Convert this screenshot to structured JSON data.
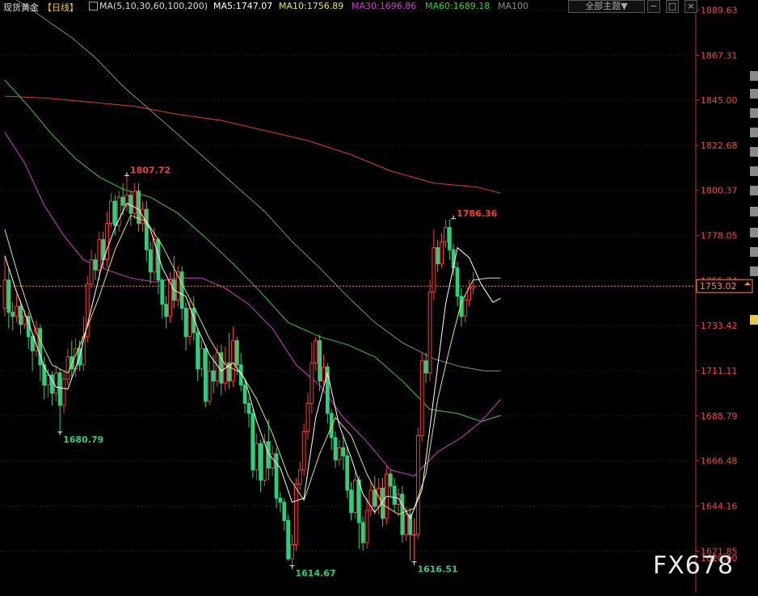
{
  "header": {
    "instrument": "现货黄金",
    "period": "【日线】",
    "ma_label": "MA(5,10,30,60,100,200)",
    "ma5": "MA5:1747.07",
    "ma10": "MA10:1756.89",
    "ma30": "MA30:1696.86",
    "ma60": "MA60:1689.18",
    "ma100": "MA100",
    "theme_button": "全部主题▼"
  },
  "colors": {
    "background": "#000000",
    "up": "#ff3b30",
    "down": "#2ad07a",
    "ma5": "#ffffff",
    "ma10": "#e8e84a",
    "ma30": "#d63ad6",
    "ma60": "#2ed62e",
    "ma100": "#8a8a8a",
    "ma200": "#e83a2a",
    "axis_text": "#ff4040",
    "price_line": "#ff8c3a"
  },
  "chart_data": {
    "type": "candlestick",
    "ylim": [
      1614,
      1893
    ],
    "y_ticks": [
      "1889.63",
      "1867.31",
      "1845.00",
      "1822.68",
      "1800.37",
      "1778.05",
      "1755.74",
      "1733.42",
      "1711.11",
      "1688.79",
      "1666.48",
      "1644.16",
      "1621.85"
    ],
    "y_tick_values": [
      1889.63,
      1867.31,
      1845.0,
      1822.68,
      1800.37,
      1778.05,
      1755.74,
      1733.42,
      1711.11,
      1688.79,
      1666.48,
      1644.16,
      1621.85
    ],
    "current_price": "1753.02",
    "current_price_value": 1753.02,
    "bottom_partial_label": "1620.00",
    "annotations": [
      {
        "text": "1807.72",
        "bar": 31,
        "price": 1807.72,
        "kind": "high"
      },
      {
        "text": "1680.79",
        "bar": 14,
        "price": 1680.79,
        "kind": "low"
      },
      {
        "text": "1614.67",
        "bar": 73,
        "price": 1614.67,
        "kind": "low"
      },
      {
        "text": "1616.51",
        "bar": 104,
        "price": 1616.51,
        "kind": "low"
      },
      {
        "text": "1786.36",
        "bar": 114,
        "price": 1786.36,
        "kind": "high"
      }
    ],
    "candles": [
      [
        1742,
        1756,
        1738,
        1768
      ],
      [
        1756,
        1740,
        1732,
        1762
      ],
      [
        1740,
        1738,
        1731,
        1745
      ],
      [
        1738,
        1743,
        1735,
        1749
      ],
      [
        1743,
        1734,
        1729,
        1746
      ],
      [
        1734,
        1738,
        1732,
        1741
      ],
      [
        1738,
        1728,
        1722,
        1740
      ],
      [
        1728,
        1721,
        1711,
        1730
      ],
      [
        1721,
        1732,
        1718,
        1736
      ],
      [
        1732,
        1714,
        1706,
        1734
      ],
      [
        1714,
        1704,
        1697,
        1718
      ],
      [
        1704,
        1709,
        1698,
        1712
      ],
      [
        1709,
        1700,
        1694,
        1711
      ],
      [
        1700,
        1710,
        1696,
        1714
      ],
      [
        1710,
        1694,
        1681,
        1712
      ],
      [
        1694,
        1707,
        1690,
        1711
      ],
      [
        1707,
        1718,
        1704,
        1722
      ],
      [
        1718,
        1712,
        1708,
        1726
      ],
      [
        1712,
        1722,
        1708,
        1727
      ],
      [
        1722,
        1714,
        1711,
        1726
      ],
      [
        1714,
        1728,
        1711,
        1738
      ],
      [
        1728,
        1754,
        1725,
        1758
      ],
      [
        1754,
        1766,
        1752,
        1771
      ],
      [
        1766,
        1761,
        1756,
        1769
      ],
      [
        1761,
        1776,
        1756,
        1780
      ],
      [
        1776,
        1766,
        1762,
        1780
      ],
      [
        1766,
        1784,
        1762,
        1790
      ],
      [
        1784,
        1795,
        1782,
        1799
      ],
      [
        1795,
        1783,
        1778,
        1798
      ],
      [
        1783,
        1797,
        1780,
        1800
      ],
      [
        1797,
        1793,
        1788,
        1804
      ],
      [
        1793,
        1798,
        1790,
        1808
      ],
      [
        1798,
        1789,
        1783,
        1800
      ],
      [
        1789,
        1800,
        1786,
        1804
      ],
      [
        1800,
        1784,
        1780,
        1804
      ],
      [
        1784,
        1791,
        1780,
        1795
      ],
      [
        1791,
        1771,
        1765,
        1795
      ],
      [
        1771,
        1760,
        1754,
        1775
      ],
      [
        1760,
        1776,
        1756,
        1782
      ],
      [
        1776,
        1756,
        1749,
        1777
      ],
      [
        1756,
        1744,
        1737,
        1757
      ],
      [
        1744,
        1738,
        1732,
        1748
      ],
      [
        1738,
        1756,
        1735,
        1760
      ],
      [
        1756,
        1746,
        1742,
        1768
      ],
      [
        1746,
        1760,
        1743,
        1763
      ],
      [
        1760,
        1742,
        1736,
        1763
      ],
      [
        1742,
        1728,
        1721,
        1745
      ],
      [
        1728,
        1742,
        1724,
        1746
      ],
      [
        1742,
        1730,
        1726,
        1748
      ],
      [
        1730,
        1712,
        1706,
        1732
      ],
      [
        1712,
        1722,
        1708,
        1726
      ],
      [
        1722,
        1696,
        1693,
        1724
      ],
      [
        1696,
        1711,
        1694,
        1716
      ],
      [
        1711,
        1706,
        1700,
        1719
      ],
      [
        1706,
        1720,
        1703,
        1724
      ],
      [
        1720,
        1705,
        1699,
        1724
      ],
      [
        1705,
        1715,
        1701,
        1723
      ],
      [
        1715,
        1706,
        1702,
        1730
      ],
      [
        1706,
        1726,
        1703,
        1733
      ],
      [
        1726,
        1714,
        1709,
        1728
      ],
      [
        1714,
        1704,
        1701,
        1720
      ],
      [
        1704,
        1695,
        1690,
        1707
      ],
      [
        1695,
        1690,
        1683,
        1698
      ],
      [
        1690,
        1662,
        1658,
        1692
      ],
      [
        1662,
        1675,
        1657,
        1680
      ],
      [
        1675,
        1657,
        1651,
        1677
      ],
      [
        1657,
        1676,
        1654,
        1680
      ],
      [
        1676,
        1663,
        1657,
        1687
      ],
      [
        1663,
        1670,
        1659,
        1674
      ],
      [
        1670,
        1648,
        1643,
        1673
      ],
      [
        1648,
        1646,
        1641,
        1651
      ],
      [
        1646,
        1637,
        1632,
        1648
      ],
      [
        1637,
        1618,
        1617,
        1640
      ],
      [
        1618,
        1625,
        1615,
        1630
      ],
      [
        1625,
        1655,
        1622,
        1658
      ],
      [
        1655,
        1662,
        1652,
        1666
      ],
      [
        1662,
        1681,
        1659,
        1685
      ],
      [
        1681,
        1695,
        1677,
        1700
      ],
      [
        1695,
        1715,
        1690,
        1725
      ],
      [
        1715,
        1726,
        1711,
        1728
      ],
      [
        1726,
        1706,
        1701,
        1729
      ],
      [
        1706,
        1713,
        1704,
        1719
      ],
      [
        1713,
        1690,
        1685,
        1715
      ],
      [
        1690,
        1678,
        1672,
        1692
      ],
      [
        1678,
        1667,
        1663,
        1681
      ],
      [
        1667,
        1673,
        1664,
        1677
      ],
      [
        1673,
        1669,
        1662,
        1679
      ],
      [
        1669,
        1652,
        1648,
        1674
      ],
      [
        1652,
        1641,
        1637,
        1656
      ],
      [
        1641,
        1657,
        1638,
        1661
      ],
      [
        1657,
        1636,
        1623,
        1659
      ],
      [
        1636,
        1626,
        1622,
        1639
      ],
      [
        1626,
        1642,
        1623,
        1648
      ],
      [
        1642,
        1652,
        1639,
        1656
      ],
      [
        1652,
        1644,
        1640,
        1659
      ],
      [
        1644,
        1653,
        1640,
        1658
      ],
      [
        1653,
        1638,
        1634,
        1658
      ],
      [
        1638,
        1660,
        1635,
        1664
      ],
      [
        1660,
        1654,
        1649,
        1662
      ],
      [
        1654,
        1645,
        1641,
        1658
      ],
      [
        1645,
        1650,
        1639,
        1653
      ],
      [
        1650,
        1630,
        1626,
        1654
      ],
      [
        1630,
        1640,
        1627,
        1644
      ],
      [
        1640,
        1630,
        1617,
        1643
      ],
      [
        1630,
        1630,
        1617,
        1638
      ],
      [
        1630,
        1679,
        1628,
        1683
      ],
      [
        1679,
        1716,
        1676,
        1720
      ],
      [
        1716,
        1710,
        1705,
        1720
      ],
      [
        1710,
        1750,
        1706,
        1756
      ],
      [
        1750,
        1772,
        1746,
        1781
      ],
      [
        1772,
        1764,
        1760,
        1776
      ],
      [
        1764,
        1775,
        1762,
        1779
      ],
      [
        1775,
        1782,
        1772,
        1786
      ],
      [
        1782,
        1771,
        1766,
        1786
      ],
      [
        1771,
        1762,
        1758,
        1774
      ],
      [
        1762,
        1748,
        1743,
        1765
      ],
      [
        1748,
        1738,
        1733,
        1752
      ],
      [
        1738,
        1746,
        1735,
        1749
      ],
      [
        1746,
        1752,
        1743,
        1756
      ],
      [
        1752,
        1753,
        1749,
        1760
      ]
    ],
    "ma100_points": [
      [
        0,
        1898
      ],
      [
        6,
        1891
      ],
      [
        11,
        1884
      ],
      [
        17,
        1876
      ],
      [
        23,
        1866
      ],
      [
        30,
        1852
      ],
      [
        37,
        1840
      ],
      [
        44,
        1828
      ],
      [
        51,
        1816
      ],
      [
        59,
        1802
      ],
      [
        66,
        1790
      ],
      [
        73,
        1775
      ],
      [
        80,
        1762
      ],
      [
        87,
        1748
      ],
      [
        94,
        1735
      ],
      [
        101,
        1725
      ],
      [
        109,
        1717
      ],
      [
        116,
        1713
      ],
      [
        122,
        1711
      ],
      [
        126,
        1711
      ]
    ],
    "ma200_points": [
      [
        0,
        1847
      ],
      [
        11,
        1846
      ],
      [
        22,
        1844
      ],
      [
        33,
        1842
      ],
      [
        44,
        1838
      ],
      [
        55,
        1835
      ],
      [
        66,
        1830
      ],
      [
        77,
        1825
      ],
      [
        88,
        1818
      ],
      [
        98,
        1810
      ],
      [
        109,
        1804
      ],
      [
        120,
        1802
      ],
      [
        126,
        1799
      ]
    ],
    "ma60_points": [
      [
        0,
        1855
      ],
      [
        6,
        1842
      ],
      [
        12,
        1828
      ],
      [
        18,
        1816
      ],
      [
        24,
        1807
      ],
      [
        30,
        1801
      ],
      [
        37,
        1797
      ],
      [
        44,
        1789
      ],
      [
        51,
        1777
      ],
      [
        58,
        1764
      ],
      [
        65,
        1750
      ],
      [
        72,
        1735
      ],
      [
        80,
        1728
      ],
      [
        87,
        1724
      ],
      [
        94,
        1718
      ],
      [
        101,
        1706
      ],
      [
        108,
        1692
      ],
      [
        115,
        1690
      ],
      [
        121,
        1686
      ],
      [
        126,
        1689
      ]
    ],
    "ma30_points": [
      [
        0,
        1829
      ],
      [
        5,
        1814
      ],
      [
        10,
        1793
      ],
      [
        15,
        1778
      ],
      [
        20,
        1766
      ],
      [
        26,
        1761
      ],
      [
        32,
        1757
      ],
      [
        38,
        1755
      ],
      [
        44,
        1757
      ],
      [
        50,
        1757
      ],
      [
        56,
        1752
      ],
      [
        62,
        1744
      ],
      [
        68,
        1732
      ],
      [
        74,
        1714
      ],
      [
        80,
        1704
      ],
      [
        86,
        1688
      ],
      [
        92,
        1676
      ],
      [
        98,
        1662
      ],
      [
        104,
        1659
      ],
      [
        110,
        1671
      ],
      [
        116,
        1678
      ],
      [
        121,
        1686
      ],
      [
        126,
        1697
      ]
    ],
    "ma10_points": [
      [
        0,
        1781
      ],
      [
        4,
        1754
      ],
      [
        8,
        1730
      ],
      [
        12,
        1714
      ],
      [
        16,
        1710
      ],
      [
        20,
        1728
      ],
      [
        24,
        1748
      ],
      [
        28,
        1771
      ],
      [
        32,
        1788
      ],
      [
        36,
        1785
      ],
      [
        40,
        1773
      ],
      [
        44,
        1758
      ],
      [
        48,
        1743
      ],
      [
        52,
        1727
      ],
      [
        56,
        1714
      ],
      [
        60,
        1710
      ],
      [
        64,
        1697
      ],
      [
        68,
        1680
      ],
      [
        72,
        1659
      ],
      [
        76,
        1647
      ],
      [
        80,
        1670
      ],
      [
        84,
        1688
      ],
      [
        88,
        1679
      ],
      [
        92,
        1660
      ],
      [
        96,
        1645
      ],
      [
        100,
        1640
      ],
      [
        104,
        1643
      ],
      [
        107,
        1660
      ],
      [
        110,
        1697
      ],
      [
        113,
        1722
      ],
      [
        116,
        1745
      ],
      [
        119,
        1756
      ],
      [
        123,
        1757
      ],
      [
        126,
        1757
      ]
    ],
    "ma5_points": [
      [
        0,
        1768
      ],
      [
        3,
        1750
      ],
      [
        6,
        1735
      ],
      [
        10,
        1713
      ],
      [
        13,
        1703
      ],
      [
        16,
        1702
      ],
      [
        19,
        1718
      ],
      [
        22,
        1742
      ],
      [
        25,
        1766
      ],
      [
        28,
        1782
      ],
      [
        31,
        1794
      ],
      [
        34,
        1791
      ],
      [
        37,
        1781
      ],
      [
        40,
        1762
      ],
      [
        43,
        1751
      ],
      [
        46,
        1748
      ],
      [
        49,
        1732
      ],
      [
        52,
        1719
      ],
      [
        55,
        1711
      ],
      [
        58,
        1715
      ],
      [
        61,
        1707
      ],
      [
        64,
        1686
      ],
      [
        67,
        1670
      ],
      [
        70,
        1663
      ],
      [
        73,
        1646
      ],
      [
        76,
        1648
      ],
      [
        79,
        1688
      ],
      [
        82,
        1710
      ],
      [
        85,
        1684
      ],
      [
        88,
        1668
      ],
      [
        91,
        1650
      ],
      [
        94,
        1641
      ],
      [
        97,
        1649
      ],
      [
        100,
        1648
      ],
      [
        103,
        1638
      ],
      [
        106,
        1652
      ],
      [
        109,
        1698
      ],
      [
        112,
        1744
      ],
      [
        115,
        1772
      ],
      [
        118,
        1767
      ],
      [
        121,
        1754
      ],
      [
        124,
        1745
      ],
      [
        126,
        1747
      ]
    ]
  }
}
